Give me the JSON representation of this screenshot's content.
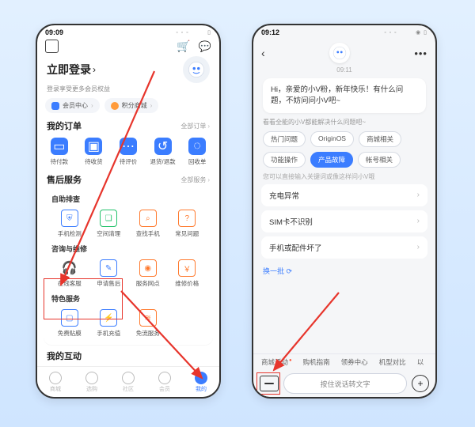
{
  "left": {
    "status_time": "09:09",
    "login_title": "立即登录",
    "login_sub": "登录享受更多会员权益",
    "pills": {
      "member": "会员中心",
      "points": "积分商城"
    },
    "orders": {
      "title": "我的订单",
      "more": "全部订单",
      "items": [
        "待付款",
        "待收货",
        "待评价",
        "退货/退款",
        "回收单"
      ]
    },
    "after": {
      "title": "售后服务",
      "more": "全部服务"
    },
    "self_check": {
      "title": "自助排查",
      "items": [
        "手机检测",
        "空间清理",
        "查找手机",
        "常见问题"
      ]
    },
    "consult": {
      "title": "咨询与维修",
      "items": [
        "在线客服",
        "申请售后",
        "服务网点",
        "维修价格"
      ]
    },
    "special": {
      "title": "特色服务",
      "items": [
        "免费贴膜",
        "手机充值",
        "免流服务"
      ]
    },
    "interact": {
      "title": "我的互动"
    },
    "tabs": [
      "商城",
      "选购",
      "社区",
      "会员",
      "我的"
    ]
  },
  "right": {
    "status_time": "09:12",
    "stamp": "09:11",
    "greet": "Hi，亲爱的小V粉，新年快乐！有什么问题，不妨问问小V吧~",
    "help": "看看全能的小V都能解决什么问题吧~",
    "chips": [
      "热门问题",
      "OriginOS",
      "商城相关",
      "功能操作",
      "产品故障",
      "帐号相关"
    ],
    "hint": "您可以直接输入关键词或像这样问小V哦",
    "qs": [
      "充电异常",
      "SIM卡不识别",
      "手机或配件坏了"
    ],
    "refresh": "换一批",
    "suggest": [
      "商城活动",
      "购机指南",
      "领券中心",
      "机型对比",
      "以"
    ],
    "voice": "按住说话转文字"
  }
}
